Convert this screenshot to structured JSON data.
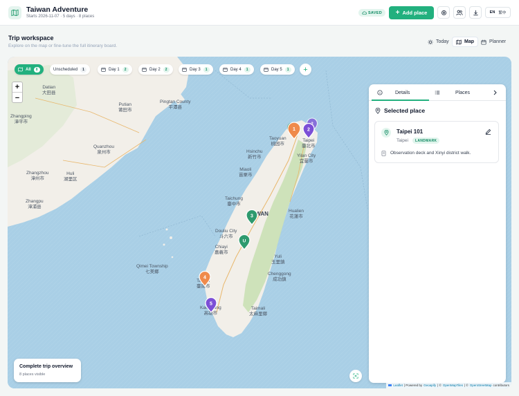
{
  "header": {
    "title": "Taiwan Adventure",
    "subtitle": "Starts 2026-11-07 · 5 days · 8 places",
    "saved_label": "SAVED",
    "add_place_label": "Add place",
    "lang_en": "EN",
    "lang_zh": "繁中"
  },
  "workspace": {
    "title": "Trip workspace",
    "subtitle": "Explore on the map or fine-tune the full itinerary board.",
    "views": [
      {
        "label": "Today"
      },
      {
        "label": "Map"
      },
      {
        "label": "Planner"
      }
    ]
  },
  "filters": [
    {
      "label": "All",
      "count": "8"
    },
    {
      "label": "Unscheduled",
      "count": "1"
    },
    {
      "label": "Day 1",
      "count": "2"
    },
    {
      "label": "Day 2",
      "count": "2"
    },
    {
      "label": "Day 3",
      "count": "1"
    },
    {
      "label": "Day 4",
      "count": "1"
    },
    {
      "label": "Day 5",
      "count": "1"
    }
  ],
  "zoom": {
    "in": "+",
    "out": "−"
  },
  "map_labels": [
    {
      "en": "Datian",
      "zh": "大田县"
    },
    {
      "en": "Putian",
      "zh": "莆田市"
    },
    {
      "en": "Pingtan County",
      "zh": "平潭县"
    },
    {
      "en": "Zhangping",
      "zh": "漳平市"
    },
    {
      "en": "Quanzhou",
      "zh": "泉州市"
    },
    {
      "en": "Zhangzhou",
      "zh": "漳州市"
    },
    {
      "en": "Huli",
      "zh": "湖里区"
    },
    {
      "en": "Zhangpu",
      "zh": "漳浦县"
    },
    {
      "en": "Hsinchu",
      "zh": "新竹市"
    },
    {
      "en": "Taoyuan",
      "zh": "桃园市"
    },
    {
      "en": "Taipei",
      "zh": "臺北市"
    },
    {
      "en": "Yilan City",
      "zh": "宜蘭市"
    },
    {
      "en": "Miaoli",
      "zh": "苗栗市"
    },
    {
      "en": "Taichung",
      "zh": "臺中市"
    },
    {
      "en": "TAIWAN",
      "zh": ""
    },
    {
      "en": "Hualien",
      "zh": "花蓮市"
    },
    {
      "en": "Douliu City",
      "zh": "斗六市"
    },
    {
      "en": "Chiayi",
      "zh": "嘉義市"
    },
    {
      "en": "Yuli",
      "zh": "玉里鎮"
    },
    {
      "en": "Qimei Township",
      "zh": "七美鄉"
    },
    {
      "en": "Tainan",
      "zh": "臺南市"
    },
    {
      "en": "Chenggong",
      "zh": "成功鎮"
    },
    {
      "en": "Kaohsiung",
      "zh": "高雄市"
    },
    {
      "en": "Taimali",
      "zh": "太麻里鄉"
    }
  ],
  "pins": [
    {
      "label": "1",
      "color": "#ef8a4b"
    },
    {
      "label": "2",
      "color": "#7c4fd6"
    },
    {
      "label": "2",
      "color": "#7c4fd6"
    },
    {
      "label": "3",
      "color": "#2e9a6e"
    },
    {
      "label": "U",
      "color": "#2e9a6e"
    },
    {
      "label": "4",
      "color": "#ef8a4b"
    },
    {
      "label": "5",
      "color": "#7c4fd6"
    }
  ],
  "panel": {
    "tab_details": "Details",
    "tab_places": "Places",
    "section_title": "Selected place",
    "place": {
      "name": "Taipei 101",
      "city": "Taipei",
      "category": "LANDMARK",
      "note": "Observation deck and Xinyi district walk."
    }
  },
  "overview": {
    "title": "Complete trip overview",
    "subtitle": "8 places visible"
  },
  "attribution": {
    "leaflet": "Leaflet",
    "powered": "| Powered by",
    "geoapify": "Geoapify",
    "sep1": "| ©",
    "omt": "OpenMapTiles",
    "sep2": "| ©",
    "osm": "OpenStreetMap",
    "contributors": "contributors"
  },
  "colors": {
    "accent": "#22b07e",
    "sea": "#a9cfe6",
    "land": "#f2efe9",
    "forest": "#c8dfb2"
  }
}
